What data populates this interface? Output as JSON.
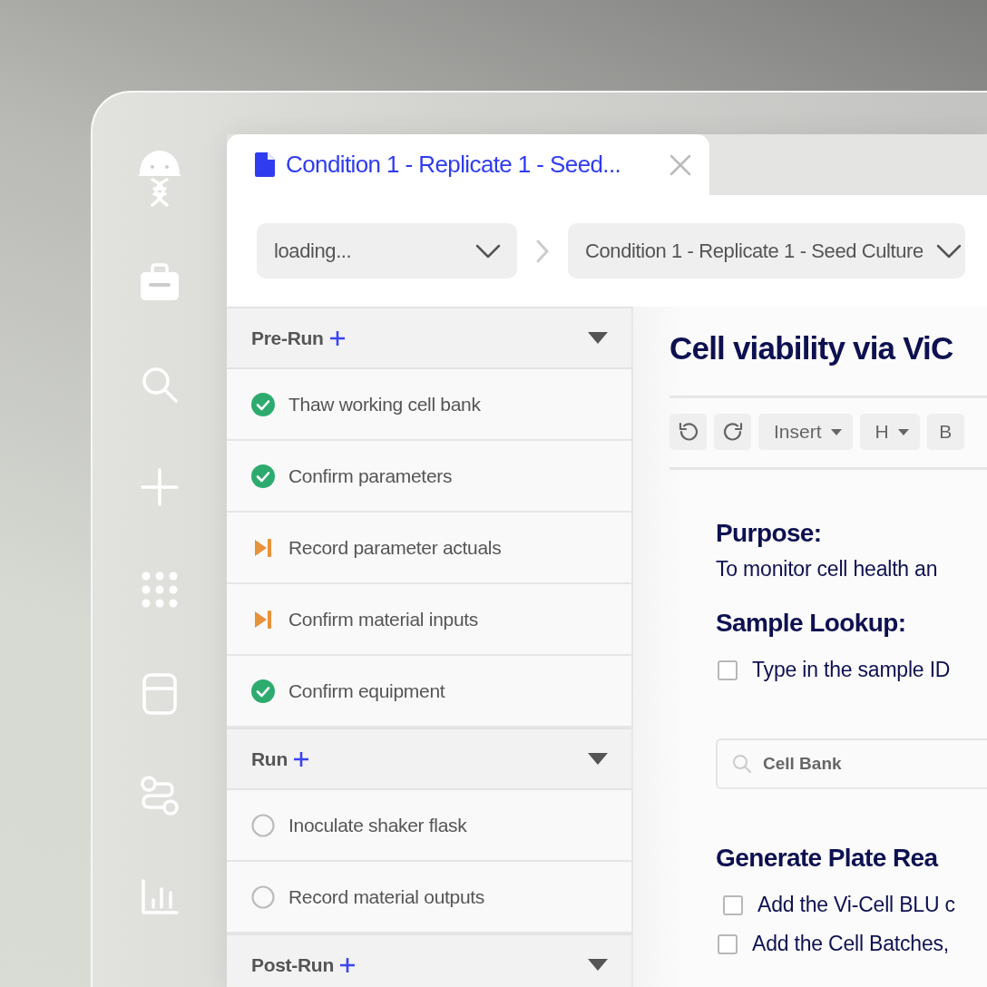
{
  "tab": {
    "title": "Condition 1 - Replicate 1 - Seed...",
    "selected": true
  },
  "breadcrumb": [
    {
      "label": "loading..."
    },
    {
      "label": "Condition 1 - Replicate 1 - Seed Culture"
    }
  ],
  "sections": [
    {
      "title": "Pre-Run",
      "expanded": true,
      "steps": [
        {
          "label": "Thaw working cell bank",
          "kind": "done"
        },
        {
          "label": "Confirm parameters",
          "kind": "done"
        },
        {
          "label": "Record parameter actuals",
          "kind": "skipped"
        },
        {
          "label": "Confirm material inputs",
          "kind": "skipped"
        },
        {
          "label": "Confirm equipment",
          "kind": "done"
        }
      ]
    },
    {
      "title": "Run",
      "expanded": true,
      "steps": [
        {
          "label": "Inoculate shaker flask",
          "kind": "pending"
        },
        {
          "label": "Record material outputs",
          "kind": "pending"
        }
      ]
    },
    {
      "title": "Post-Run",
      "expanded": true
    }
  ],
  "document": {
    "title": "Cell viability via ViC",
    "toolbar": [
      {
        "kind": "undo"
      },
      {
        "kind": "redo"
      },
      {
        "kind": "menu",
        "label": "Insert"
      },
      {
        "kind": "menu",
        "label": "H"
      },
      {
        "kind": "text",
        "label": "B"
      }
    ],
    "blocks": [
      {
        "kind": "heading",
        "text": "Purpose:"
      },
      {
        "kind": "paragraph",
        "text": "To monitor cell health an"
      },
      {
        "kind": "heading",
        "text": "Sample Lookup:"
      },
      {
        "kind": "checkbox",
        "text": "Type in the sample ID",
        "checked": false
      },
      {
        "kind": "search",
        "placeholder": "Cell Bank"
      },
      {
        "kind": "heading",
        "text": "Generate Plate Rea"
      },
      {
        "kind": "checkbox",
        "text": "Add the Vi-Cell BLU c",
        "checked": false
      },
      {
        "kind": "checkbox",
        "text": "Add the Cell Batches,",
        "checked": false
      }
    ]
  }
}
